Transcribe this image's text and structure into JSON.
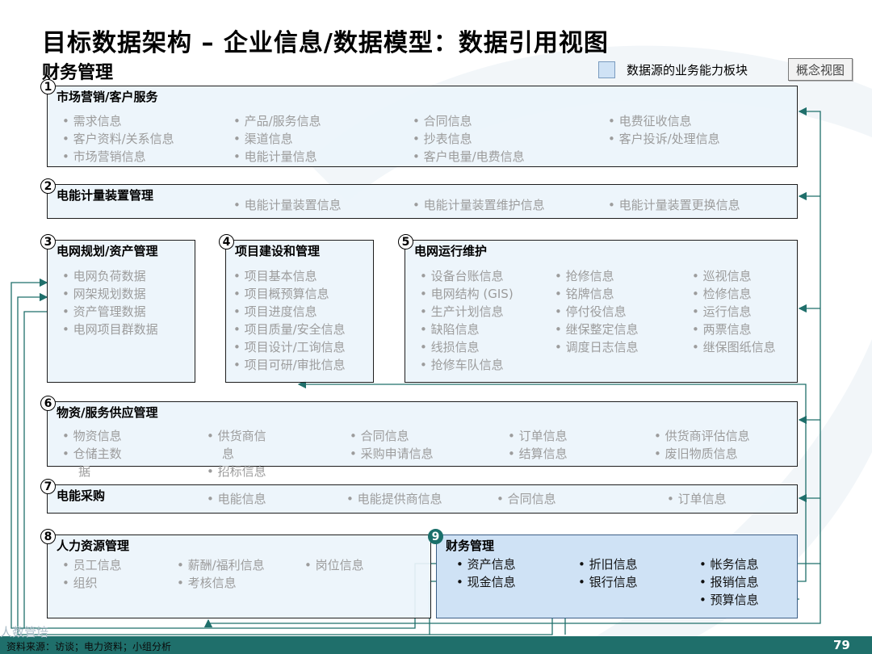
{
  "title": "目标数据架构 – 企业信息/数据模型：数据引用视图",
  "subtitle": "财务管理",
  "legend": {
    "label": "数据源的业务能力板块",
    "color": "#cfe2f5"
  },
  "badge": "概念视图",
  "boxes": [
    {
      "number": "1",
      "title": "市场营销/客户服务",
      "items": [
        "需求信息",
        "客户资料/关系信息",
        "市场营销信息",
        "产品/服务信息",
        "渠道信息",
        "电能计量信息",
        "合同信息",
        "抄表信息",
        "客户电量/电费信息",
        "电费征收信息",
        "客户投诉/处理信息"
      ]
    },
    {
      "number": "2",
      "title": "电能计量装置管理",
      "items": [
        "电能计量装置信息",
        "电能计量装置维护信息",
        "电能计量装置更换信息"
      ]
    },
    {
      "number": "3",
      "title": "电网规划/资产管理",
      "items": [
        "电网负荷数据",
        "网架规划数据",
        "资产管理数据",
        "电网项目群数据"
      ]
    },
    {
      "number": "4",
      "title": "项目建设和管理",
      "items": [
        "项目基本信息",
        "项目概预算信息",
        "项目进度信息",
        "项目质量/安全信息",
        "项目设计/工询信息",
        "项目可研/审批信息"
      ]
    },
    {
      "number": "5",
      "title": "电网运行维护",
      "items": [
        "设备台账信息",
        "电网结构 (GIS)",
        "生产计划信息",
        "缺陷信息",
        "线损信息",
        "抢修车队信息",
        "抢修信息",
        "铭牌信息",
        "停付役信息",
        "继保整定信息",
        "调度日志信息",
        "巡视信息",
        "检修信息",
        "运行信息",
        "两票信息",
        "继保图纸信息"
      ]
    },
    {
      "number": "6",
      "title": "物资/服务供应管理",
      "items": [
        "物资信息",
        "仓储主数",
        "据",
        "供货商信",
        "息",
        "招标信息",
        "合同信息",
        "采购申请信息",
        "订单信息",
        "结算信息",
        "供货商评估信息",
        "废旧物质信息"
      ]
    },
    {
      "number": "7",
      "title": "电能采购",
      "items": [
        "电能信息",
        "电能提供商信息",
        "合同信息",
        "订单信息"
      ]
    },
    {
      "number": "8",
      "title": "人力资源管理",
      "items": [
        "员工信息",
        "组织",
        "薪酬/福利信息",
        "考核信息",
        "岗位信息"
      ]
    },
    {
      "number": "9",
      "title": "财务管理",
      "items": [
        "资产信息",
        "现金信息",
        "折旧信息",
        "银行信息",
        "帐务信息",
        "报销信息",
        "预算信息"
      ]
    }
  ],
  "footer": {
    "source": "资料来源：访谈；电力资料；小组分析",
    "page": "79"
  },
  "watermark": "人数管培",
  "colors": {
    "teal": "#1f6f6b",
    "box_fill": "#ecf4fb",
    "highlight_fill": "#cfe2f5"
  }
}
